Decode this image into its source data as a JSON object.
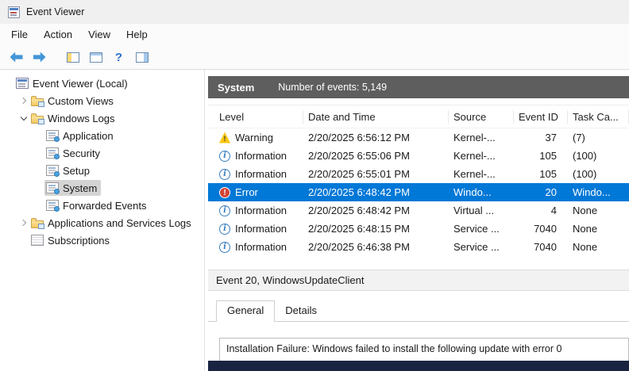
{
  "window": {
    "title": "Event Viewer"
  },
  "menu": {
    "items": [
      "File",
      "Action",
      "View",
      "Help"
    ]
  },
  "toolbar": {
    "buttons": [
      {
        "icon": "back-arrow"
      },
      {
        "icon": "forward-arrow"
      },
      {
        "icon": "console-tree",
        "group_start": true
      },
      {
        "icon": "window-panel"
      },
      {
        "icon": "help"
      },
      {
        "icon": "action-pane"
      }
    ]
  },
  "tree": {
    "items": [
      {
        "label": "Event Viewer (Local)",
        "icon": "event-viewer",
        "level": 0
      },
      {
        "label": "Custom Views",
        "icon": "folder",
        "level": 1,
        "expander": "chevron-collapsed"
      },
      {
        "label": "Windows Logs",
        "icon": "folder",
        "level": 1,
        "expander": "chevron-expanded"
      },
      {
        "label": "Application",
        "icon": "event-log",
        "level": 2
      },
      {
        "label": "Security",
        "icon": "event-log",
        "level": 2
      },
      {
        "label": "Setup",
        "icon": "event-log",
        "level": 2
      },
      {
        "label": "System",
        "icon": "event-log",
        "level": 2,
        "selected": true
      },
      {
        "label": "Forwarded Events",
        "icon": "event-log",
        "level": 2
      },
      {
        "label": "Applications and Services Logs",
        "icon": "folder",
        "level": 1,
        "expander": "chevron-collapsed"
      },
      {
        "label": "Subscriptions",
        "icon": "subscriptions",
        "level": 1
      }
    ]
  },
  "main": {
    "header": {
      "title": "System",
      "subtitle": "Number of events: 5,149"
    },
    "table": {
      "columns": [
        "Level",
        "Date and Time",
        "Source",
        "Event ID",
        "Task Ca..."
      ],
      "rows": [
        {
          "icon": "warning",
          "level": "Warning",
          "datetime": "2/20/2025 6:56:12 PM",
          "source": "Kernel-...",
          "event_id": "37",
          "task": "(7)"
        },
        {
          "icon": "information",
          "level": "Information",
          "datetime": "2/20/2025 6:55:06 PM",
          "source": "Kernel-...",
          "event_id": "105",
          "task": "(100)"
        },
        {
          "icon": "information",
          "level": "Information",
          "datetime": "2/20/2025 6:55:01 PM",
          "source": "Kernel-...",
          "event_id": "105",
          "task": "(100)"
        },
        {
          "icon": "error",
          "level": "Error",
          "datetime": "2/20/2025 6:48:42 PM",
          "source": "Windo...",
          "event_id": "20",
          "task": "Windo...",
          "selected": true
        },
        {
          "icon": "information",
          "level": "Information",
          "datetime": "2/20/2025 6:48:42 PM",
          "source": "Virtual ...",
          "event_id": "4",
          "task": "None"
        },
        {
          "icon": "information",
          "level": "Information",
          "datetime": "2/20/2025 6:48:15 PM",
          "source": "Service ...",
          "event_id": "7040",
          "task": "None"
        },
        {
          "icon": "information",
          "level": "Information",
          "datetime": "2/20/2025 6:46:38 PM",
          "source": "Service ...",
          "event_id": "7040",
          "task": "None"
        }
      ]
    },
    "details": {
      "title": "Event 20, WindowsUpdateClient",
      "tabs": [
        {
          "label": "General",
          "active": true
        },
        {
          "label": "Details",
          "active": false
        }
      ],
      "content": "Installation Failure: Windows failed to install the following update with error 0"
    }
  },
  "colors": {
    "selection-blue": "#0078d7",
    "header-bar-gray": "#5e5e5e",
    "error-red": "#d24437",
    "warning-yellow": "#fcc60e",
    "info-blue": "#3a7ebf",
    "taskbar-navy": "#1a2440",
    "toolbar-arrow-blue": "#4395d6"
  }
}
